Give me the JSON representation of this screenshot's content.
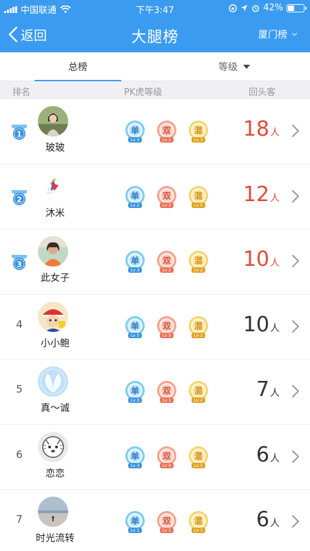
{
  "status_bar": {
    "carrier": "中国联通",
    "time": "下午3:47",
    "battery": "42%",
    "battery_level": 0.42
  },
  "nav": {
    "back_label": "返回",
    "title": "大腿榜",
    "city_label": "厦门榜"
  },
  "tabs": {
    "total": "总榜",
    "level": "等级"
  },
  "columns": {
    "rank": "排名",
    "level": "PK虎等级",
    "returning": "回头客"
  },
  "colors": {
    "accent": "#3a9bf0",
    "top_count": "#e04b3a",
    "count": "#333333"
  },
  "rows": [
    {
      "rank": "1",
      "name": "玻玻",
      "count": "18",
      "unit": "人",
      "levels": [
        "Lv 3",
        "Lv 1",
        "Lv 3"
      ]
    },
    {
      "rank": "2",
      "name": "沐米",
      "count": "12",
      "unit": "人",
      "levels": [
        "Lv 2",
        "Lv 3",
        "Lv 5"
      ]
    },
    {
      "rank": "3",
      "name": "此女子",
      "count": "10",
      "unit": "人",
      "levels": [
        "Lv 3",
        "Lv 2",
        "Lv 2"
      ]
    },
    {
      "rank": "4",
      "name": "小小鲍",
      "count": "10",
      "unit": "人",
      "levels": [
        "Lv 5",
        "Lv 5",
        "Lv 2"
      ]
    },
    {
      "rank": "5",
      "name": "真～诚",
      "count": "7",
      "unit": "人",
      "levels": [
        "Lv 3",
        "Lv 1",
        "Lv 2"
      ]
    },
    {
      "rank": "6",
      "name": "恋恋",
      "count": "6",
      "unit": "人",
      "levels": [
        "Lv 3",
        "Lv 0",
        "Lv 5"
      ]
    },
    {
      "rank": "7",
      "name": "时光流转",
      "count": "6",
      "unit": "人",
      "levels": [
        "Lv 1",
        "Lv 1",
        "Lv 1"
      ]
    }
  ],
  "badge_chars": [
    "单",
    "双",
    "混"
  ]
}
